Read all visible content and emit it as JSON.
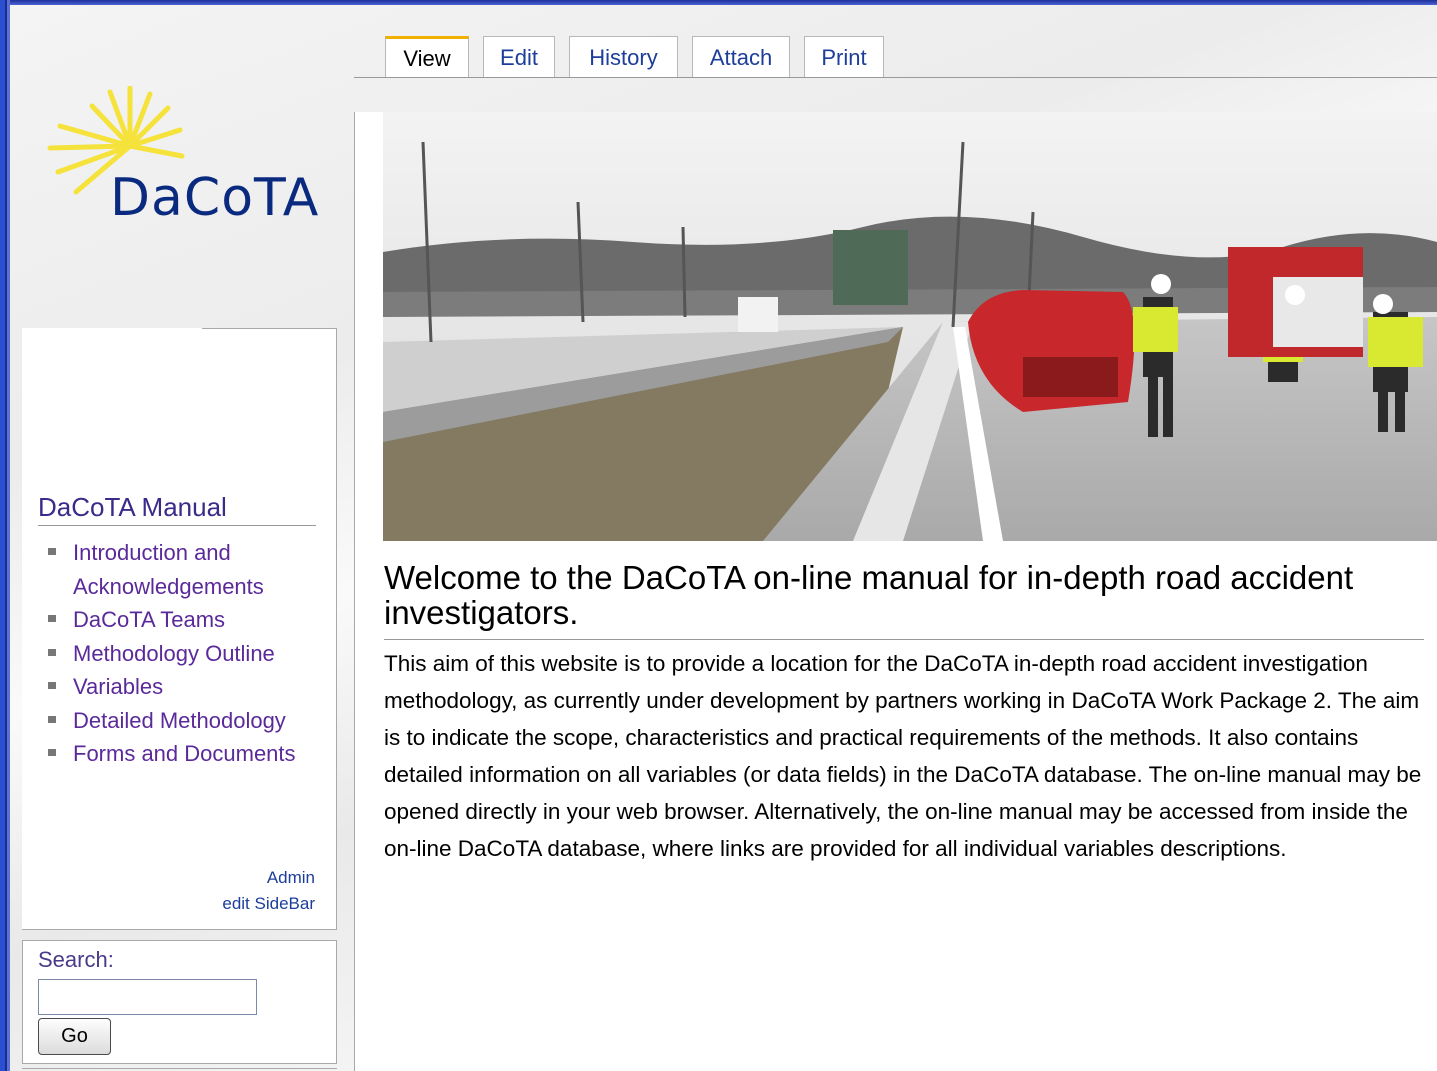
{
  "tabs": [
    {
      "label": "View",
      "active": true
    },
    {
      "label": "Edit",
      "active": false
    },
    {
      "label": "History",
      "active": false
    },
    {
      "label": "Attach",
      "active": false
    },
    {
      "label": "Print",
      "active": false
    }
  ],
  "logo": {
    "text": "DaCoTA"
  },
  "sidebar": {
    "title": "DaCoTA Manual",
    "items": [
      {
        "label": "Introduction and Acknowledgements"
      },
      {
        "label": "DaCoTA Teams"
      },
      {
        "label": "Methodology Outline"
      },
      {
        "label": "Variables"
      },
      {
        "label": "Detailed Methodology"
      },
      {
        "label": "Forms and Documents"
      }
    ],
    "admin_link": "Admin",
    "edit_sidebar_link": "edit SideBar"
  },
  "search": {
    "label": "Search:",
    "value": "",
    "button_label": "Go"
  },
  "main": {
    "title": "Welcome to the DaCoTA on-line manual for in-depth road accident investigators.",
    "body": "This aim of this website is to provide a location for the DaCoTA in-depth road accident investigation methodology, as currently under development by partners working in DaCoTA Work Package 2. The aim is to indicate the scope, characteristics and practical requirements of the methods. It also contains detailed information on all variables (or data fields) in the DaCoTA database. The on-line manual may be opened directly in your web browser. Alternatively, the on-line manual may be accessed from inside the on-line DaCoTA database, where links are provided for all individual variables descriptions."
  },
  "colors": {
    "link": "#1c3e9a",
    "nav_link": "#5b2a9a",
    "active_tab_accent": "#f0b000",
    "logo_text": "#0a2a80",
    "logo_rays": "#f5e23a"
  }
}
